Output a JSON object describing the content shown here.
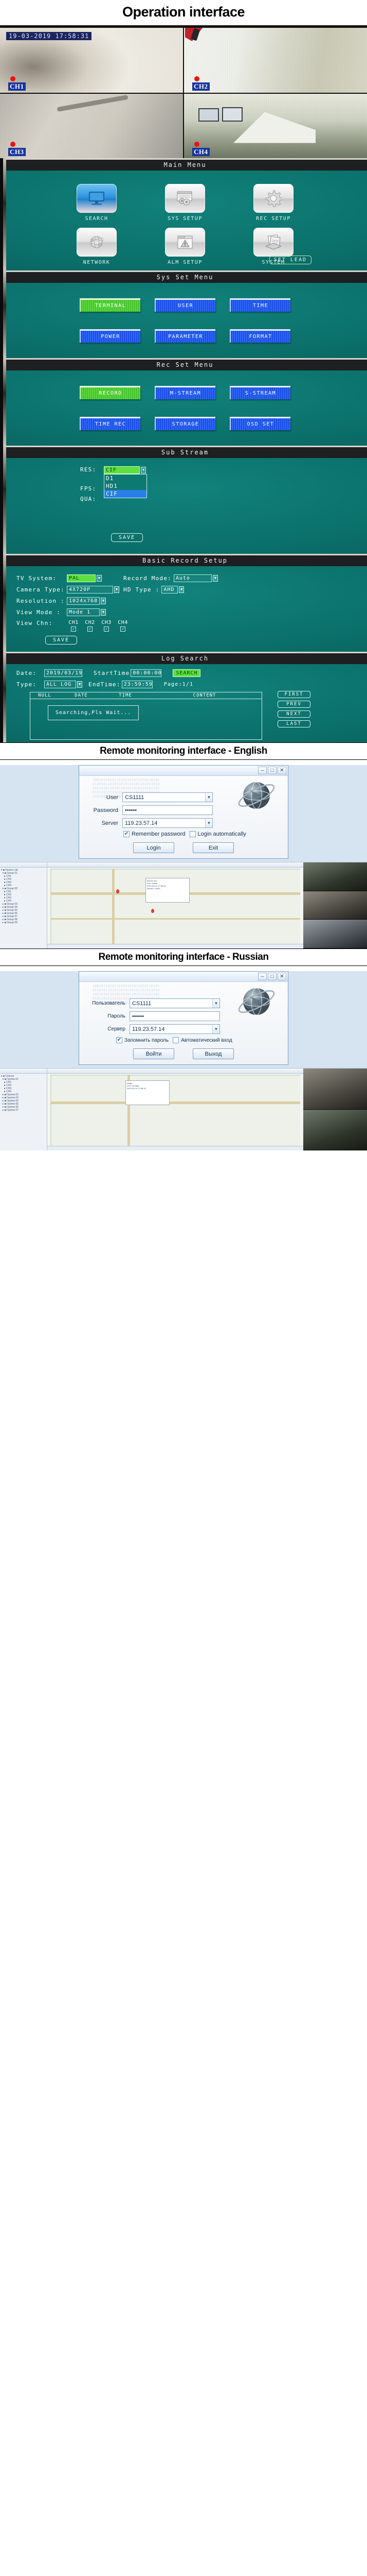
{
  "headings": {
    "main": "Operation interface",
    "english": "Remote monitoring interface - English",
    "russian": "Remote monitoring interface - Russian"
  },
  "cameras": {
    "timestamp": "19-03-2019  17:58:31",
    "channels": [
      {
        "label": "CH1",
        "recording": "rec"
      },
      {
        "label": "CH2",
        "recording": "rec"
      },
      {
        "label": "CH3",
        "recording": "rec"
      },
      {
        "label": "CH4",
        "recording": "rec"
      }
    ]
  },
  "main_menu": {
    "title": "Main Menu",
    "items": [
      {
        "label": "SEARCH",
        "icon": "monitor-icon",
        "selected": true
      },
      {
        "label": "SYS SETUP",
        "icon": "window-gear-icon",
        "selected": false
      },
      {
        "label": "REC SETUP",
        "icon": "gear-icon",
        "selected": false
      },
      {
        "label": "NETWORK",
        "icon": "globe-network-icon",
        "selected": false
      },
      {
        "label": "ALM SETUP",
        "icon": "alert-window-icon",
        "selected": false
      },
      {
        "label": "SYSTEM",
        "icon": "documents-icon",
        "selected": false
      }
    ],
    "set_lead": "SET LEAD"
  },
  "sys_set_menu": {
    "title": "Sys Set Menu",
    "row1": [
      {
        "label": "TERMINAL",
        "state": "selected"
      },
      {
        "label": "USER",
        "state": "normal"
      },
      {
        "label": "TIME",
        "state": "normal"
      }
    ],
    "row2": [
      {
        "label": "POWER",
        "state": "normal"
      },
      {
        "label": "PARAMETER",
        "state": "normal"
      },
      {
        "label": "FORMAT",
        "state": "normal"
      }
    ]
  },
  "rec_set_menu": {
    "title": "Rec Set Menu",
    "row1": [
      {
        "label": "RECORD",
        "state": "selected"
      },
      {
        "label": "M-STREAM",
        "state": "normal"
      },
      {
        "label": "S-STREAM",
        "state": "normal"
      }
    ],
    "row2": [
      {
        "label": "TIME REC",
        "state": "normal"
      },
      {
        "label": "STORAGE",
        "state": "normal"
      },
      {
        "label": "OSD SET",
        "state": "normal"
      }
    ]
  },
  "sub_stream": {
    "title": "Sub Stream",
    "fields": [
      {
        "label": "RES:",
        "value": "CIF"
      },
      {
        "label": "FPS:",
        "value": ""
      },
      {
        "label": "QUA:",
        "value": ""
      }
    ],
    "dropdown_options": [
      "D1",
      "HD1",
      "CIF"
    ],
    "dropdown_selected": "CIF",
    "save_label": "SAVE"
  },
  "basic_record_setup": {
    "title": "Basic Record Setup",
    "tv_system_label": "TV  System:",
    "tv_system_value": "PAL",
    "record_mode_label": "Record Mode:",
    "record_mode_value": "Auto",
    "camera_type_label": "Camera Type:",
    "camera_type_value": "4X720P",
    "hd_type_label": "HD Type    :",
    "hd_type_value": "AHD",
    "resolution_label": "Resolution :",
    "resolution_value": "1024x768",
    "view_mode_label": "View Mode  :",
    "view_mode_value": "Mode 1",
    "view_chn_label": "View Chn:",
    "view_chn_channels": [
      "CH1",
      "CH2",
      "CH3",
      "CH4"
    ],
    "view_chn_checked": [
      true,
      true,
      true,
      true
    ],
    "save_label": "SAVE"
  },
  "log_search": {
    "title": "Log Search",
    "date_label": "Date:",
    "date_value": "2019/03/19",
    "start_time_label": "StartTime",
    "start_time_value": "00:00:00",
    "search_label": "SEARCH",
    "type_label": "Type:",
    "type_value": "ALL LOG",
    "end_time_label": "EndTime:",
    "end_time_value": "23:59:59",
    "page_label": "Page:1/1",
    "columns": [
      "NULL",
      "DATE",
      "TIME",
      "CONTENT"
    ],
    "status_text": "Searching,Pls Wait...",
    "nav_buttons": [
      "FIRST",
      "PREV",
      "NEXT",
      "LAST"
    ]
  },
  "login_en": {
    "user_label": "User",
    "user_value": "CS1111",
    "password_label": "Password",
    "password_value": "••••••",
    "server_label": "Server",
    "server_value": "119.23.57.14",
    "remember_label": "Remember password",
    "auto_label": "Login automatically",
    "remember_checked": "✔",
    "auto_checked": "",
    "login_label": "Login",
    "exit_label": "Exit",
    "minimize": "–",
    "maximize": "□",
    "close": "✕"
  },
  "login_ru": {
    "user_label": "Пользователь",
    "user_value": "CS1111",
    "password_label": "Пароль",
    "password_value": "••••••",
    "server_label": "Сервер",
    "server_value": "119.23.57.14",
    "remember_label": "Запомнить пароль",
    "auto_label": "Автоматический вход",
    "remember_checked": "✔",
    "auto_checked": "",
    "login_label": "Войти",
    "exit_label": "Выход",
    "minimize": "–",
    "maximize": "□",
    "close": "✕"
  },
  "colors": {
    "osd_bg": "#0b6f6a",
    "accent_green": "#5ee03f",
    "accent_blue": "#1b4fe8",
    "rec_red": "#ee1111",
    "ch_badge_blue": "#18359c"
  }
}
